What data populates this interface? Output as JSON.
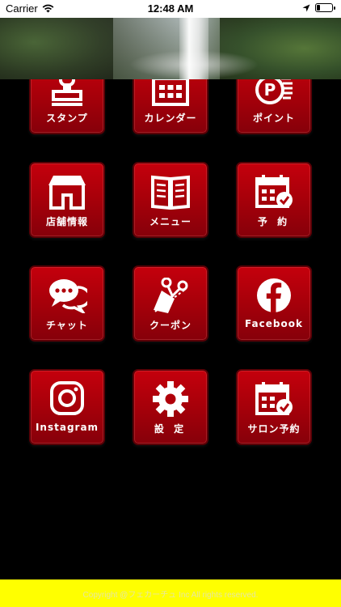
{
  "status_bar": {
    "carrier": "Carrier",
    "time": "12:48 AM",
    "battery_level": 0.2
  },
  "menu": {
    "row1": [
      {
        "label": "スタンプ",
        "icon": "stamp-icon"
      },
      {
        "label": "カレンダー",
        "icon": "calendar-icon"
      },
      {
        "label": "ポイント",
        "icon": "points-coin-icon"
      }
    ],
    "row2": [
      {
        "label": "店舗情報",
        "icon": "store-icon"
      },
      {
        "label": "メニュー",
        "icon": "book-menu-icon"
      },
      {
        "label": "予 約",
        "icon": "reservation-calendar-icon"
      }
    ],
    "row3": [
      {
        "label": "チャット",
        "icon": "chat-bubbles-icon"
      },
      {
        "label": "クーポン",
        "icon": "coupon-scissors-icon"
      },
      {
        "label": "Facebook",
        "icon": "facebook-icon"
      }
    ],
    "row4": [
      {
        "label": "Instagram",
        "icon": "instagram-icon"
      },
      {
        "label": "設 定",
        "icon": "gear-icon"
      },
      {
        "label": "サロン予約",
        "icon": "salon-reservation-icon"
      }
    ]
  },
  "footer": {
    "copyright": "Copyright @フェカーチュ Inc All rights reserved."
  },
  "colors": {
    "tile": "#b0000a",
    "footer": "#ffff00",
    "background": "#000000"
  }
}
